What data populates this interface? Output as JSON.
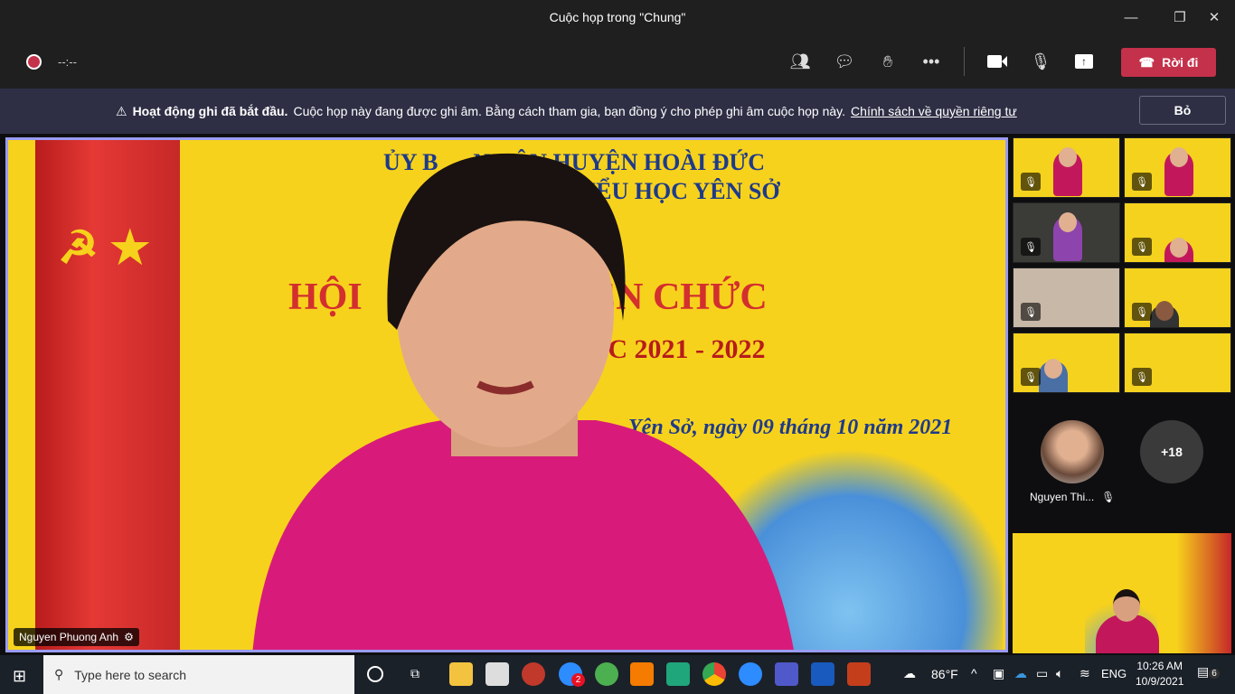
{
  "window": {
    "title": "Cuộc họp trong \"Chung\""
  },
  "toolbar": {
    "timer": "--:--",
    "leave_label": "Rời đi",
    "colors": {
      "leave": "#c4314b",
      "record": "#c4314b"
    }
  },
  "banner": {
    "bold": "Hoạt động ghi đã bắt đầu.",
    "message": "Cuộc họp này đang được ghi âm. Bằng cách tham gia, bạn đồng ý cho phép ghi âm cuộc họp này.",
    "link": "Chính sách về quyền riêng tư",
    "dismiss": "Bỏ"
  },
  "main_video": {
    "participant": "Nguyen Phuong Anh",
    "backdrop": {
      "line1": "ỦY B      N DÂN HUYỆN HOÀI ĐỨC",
      "line2": "IỂU HỌC YÊN SỞ",
      "line3": "HỘI        N BỘ, VIÊN CHỨC",
      "line4": "ỌC 2021 - 2022",
      "line5": "Yên Sở, ngày 09 tháng 10 năm 2021"
    }
  },
  "roster": {
    "avatar_name": "Nguyen Thi...",
    "overflow": "+18"
  },
  "taskbar": {
    "search_placeholder": "Type here to search",
    "weather": "86°F",
    "lang": "ENG",
    "time": "10:26 AM",
    "date": "10/9/2021",
    "notifications": "6",
    "teams_badge": "2"
  }
}
